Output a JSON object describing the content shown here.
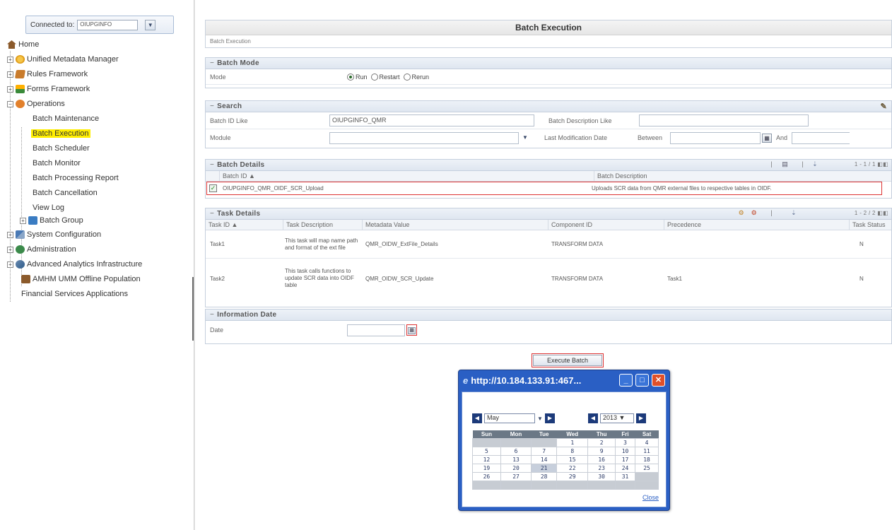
{
  "nav": {
    "connected_label": "Connected to:",
    "connected_value": "OIUPGINFO",
    "items": [
      {
        "label": "Home"
      },
      {
        "label": "Unified Metadata Manager"
      },
      {
        "label": "Rules Framework"
      },
      {
        "label": "Forms Framework"
      },
      {
        "label": "Operations"
      },
      {
        "label": "Batch Maintenance"
      },
      {
        "label": "Batch Execution"
      },
      {
        "label": "Batch Scheduler"
      },
      {
        "label": "Batch Monitor"
      },
      {
        "label": "Batch Processing Report"
      },
      {
        "label": "Batch Cancellation"
      },
      {
        "label": "View Log"
      },
      {
        "label": "Batch Group"
      },
      {
        "label": "System Configuration"
      },
      {
        "label": "Administration"
      },
      {
        "label": "Advanced Analytics Infrastructure"
      },
      {
        "label": "AMHM UMM Offline Population"
      },
      {
        "label": "Financial Services Applications"
      }
    ]
  },
  "page": {
    "title": "Batch Execution",
    "breadcrumb": "Batch Execution"
  },
  "batch_mode": {
    "header": "Batch Mode",
    "label": "Mode",
    "options": [
      "Run",
      "Restart",
      "Rerun"
    ],
    "selected": "Run"
  },
  "search": {
    "header": "Search",
    "batch_id_label": "Batch ID Like",
    "batch_id_value": "OIUPGINFO_QMR",
    "batch_desc_label": "Batch Description Like",
    "batch_desc_value": "",
    "module_label": "Module",
    "module_value": "",
    "last_mod_label": "Last Modification Date",
    "between_label": "Between",
    "and_label": "And"
  },
  "batch_details": {
    "header": "Batch Details",
    "pager": "1 - 1 / 1",
    "columns": [
      "Batch ID ▲",
      "Batch Description"
    ],
    "rows": [
      {
        "batch_id": "OIUPGINFO_QMR_OIDF_SCR_Upload",
        "description": "Uploads SCR data from QMR external files to respective tables in OIDF."
      }
    ]
  },
  "task_details": {
    "header": "Task Details",
    "pager": "1 - 2 / 2",
    "columns": [
      "Task ID ▲",
      "Task Description",
      "Metadata Value",
      "Component ID",
      "Precedence",
      "Task Status"
    ],
    "rows": [
      {
        "task_id": "Task1",
        "desc": "This task will map name path and format of the ext file",
        "metadata": "QMR_OIDW_ExtFile_Details",
        "component": "TRANSFORM DATA",
        "precedence": "",
        "status": "N"
      },
      {
        "task_id": "Task2",
        "desc": "This task calls functions to update SCR data into OIDF table",
        "metadata": "QMR_OIDW_SCR_Update",
        "component": "TRANSFORM DATA",
        "precedence": "Task1",
        "status": "N"
      }
    ]
  },
  "info_date": {
    "header": "Information Date",
    "label": "Date",
    "value": ""
  },
  "execute_button": "Execute Batch",
  "popup": {
    "title": "http://10.184.133.91:467...",
    "month": "May",
    "year": "2013",
    "weekdays": [
      "Sun",
      "Mon",
      "Tue",
      "Wed",
      "Thu",
      "Fri",
      "Sat"
    ],
    "weeks": [
      [
        "",
        "",
        "",
        "1",
        "2",
        "3",
        "4"
      ],
      [
        "5",
        "6",
        "7",
        "8",
        "9",
        "10",
        "11"
      ],
      [
        "12",
        "13",
        "14",
        "15",
        "16",
        "17",
        "18"
      ],
      [
        "19",
        "20",
        "21",
        "22",
        "23",
        "24",
        "25"
      ],
      [
        "26",
        "27",
        "28",
        "29",
        "30",
        "31",
        ""
      ],
      [
        "",
        "",
        "",
        "",
        "",
        "",
        ""
      ]
    ],
    "today": "21",
    "close_label": "Close"
  },
  "colors": {
    "highlight": "#ffee00",
    "callout_red": "#dd3333",
    "popup_blue": "#2a5fc4"
  }
}
